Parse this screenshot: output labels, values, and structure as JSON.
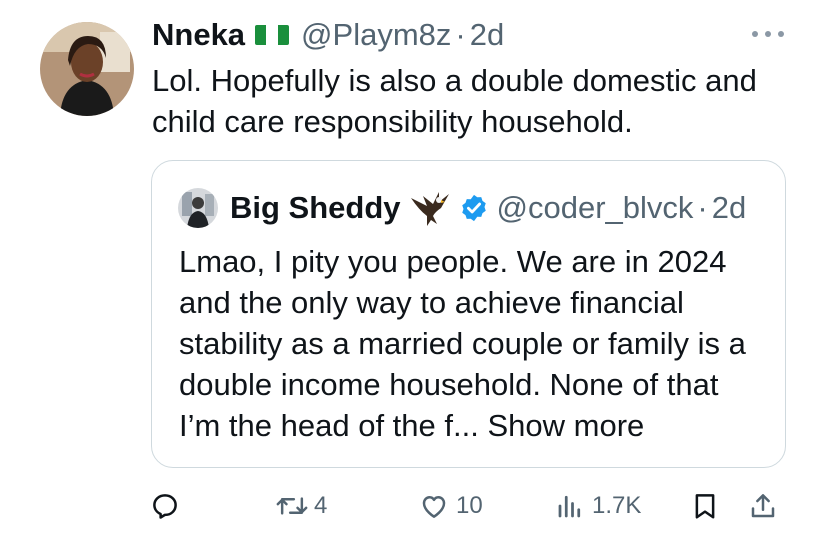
{
  "tweet": {
    "author_name": "Nneka",
    "handle": "@Playm8z",
    "separator": "·",
    "time": "2d",
    "text": "Lol. Hopefully is also a double domestic and child care responsibility household."
  },
  "quoted_tweet": {
    "author_name": "Big Sheddy",
    "handle": "@coder_blvck",
    "separator": "·",
    "time": "2d",
    "text": "Lmao, I pity you people. We are in 2024 and the only way to achieve financial stability as a married couple or family is a double income household. None of that I’m the head of the f...",
    "show_more": "Show more"
  },
  "actions": {
    "retweets": "4",
    "likes": "10",
    "views": "1.7K"
  },
  "colors": {
    "accent": "#1d9bf0",
    "secondary_text": "#536471",
    "border": "#cfd9de"
  },
  "icons": [
    "nigeria-flag-icon",
    "more-icon",
    "eagle-emoji-icon",
    "verified-badge-icon",
    "reply-icon",
    "retweet-icon",
    "like-icon",
    "views-icon",
    "bookmark-icon",
    "share-icon"
  ]
}
